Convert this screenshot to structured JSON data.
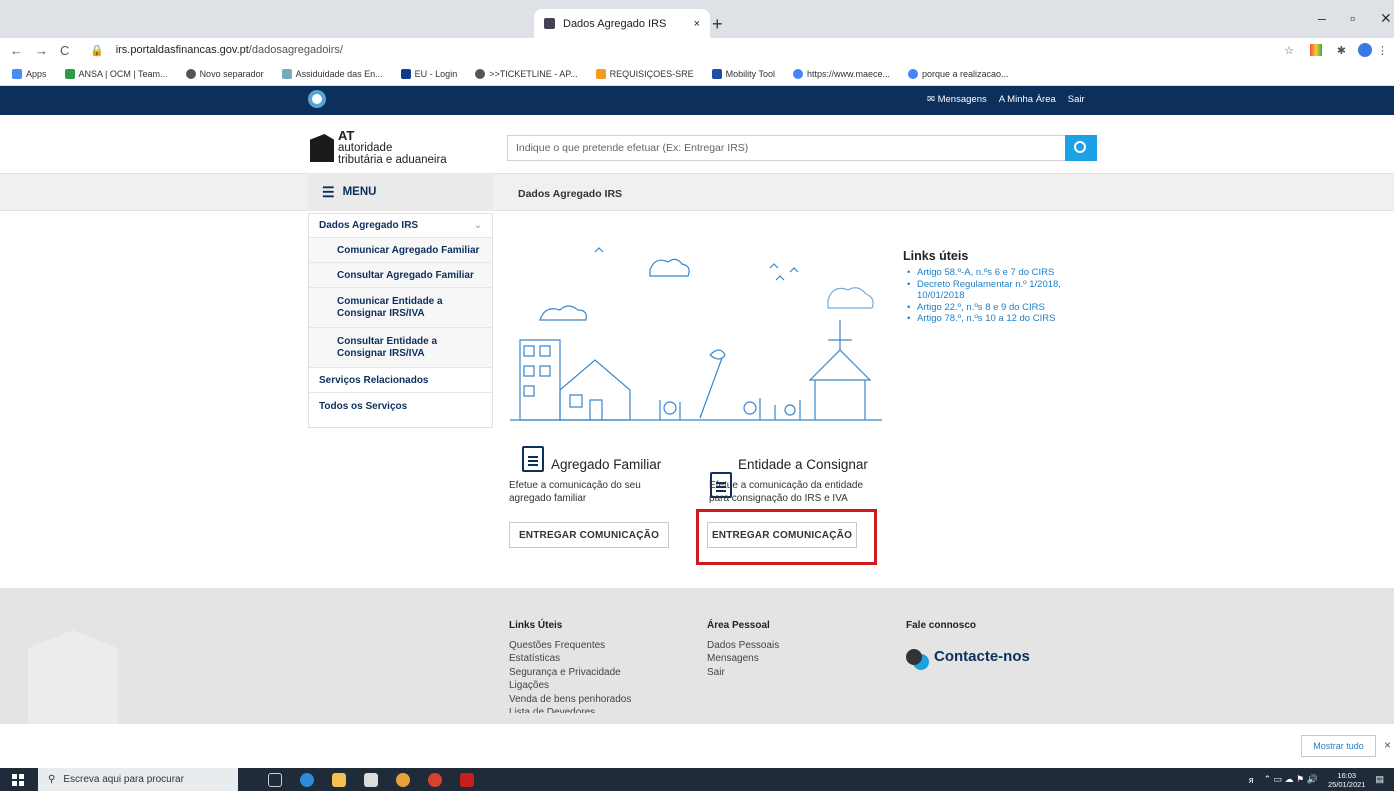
{
  "browser": {
    "tab_title": "Dados Agregado IRS",
    "url_domain": "irs.portaldasfinancas.gov.pt",
    "url_path": "/dadosagregadoirs/",
    "new_tab": "+",
    "close_tab": "×"
  },
  "bookmarks": [
    "Apps",
    "ANSA | OCM | Team...",
    "Novo separador",
    "Assiduidade das En...",
    "EU - Login",
    ">>TICKETLINE - AP...",
    "REQUISIÇOES-SRE",
    "Mobility Tool",
    "https://www.maece...",
    "porque a realizacao..."
  ],
  "topnav": {
    "messages": "Mensagens",
    "my_area": "A Minha Área",
    "exit": "Sair"
  },
  "brand": {
    "line1": "AT",
    "line2": "autoridade",
    "line3": "tributária e aduaneira"
  },
  "search": {
    "placeholder": "Indique o que pretende efetuar (Ex: Entregar IRS)"
  },
  "menu": {
    "label": "MENU",
    "breadcrumb": "Dados Agregado IRS"
  },
  "sidemenu": [
    {
      "label": "Dados Agregado IRS",
      "sub": false
    },
    {
      "label": "Comunicar Agregado Familiar",
      "sub": true
    },
    {
      "label": "Consultar Agregado Familiar",
      "sub": true
    },
    {
      "label": "Comunicar Entidade a Consignar IRS/IVA",
      "sub": true
    },
    {
      "label": "Consultar Entidade a Consignar IRS/IVA",
      "sub": true
    },
    {
      "label": "Serviços Relacionados",
      "sub": false
    },
    {
      "label": "Todos os Serviços",
      "sub": false
    }
  ],
  "cards": [
    {
      "title": "Agregado Familiar",
      "desc_line1": "Efetue a comunicação do seu",
      "desc_line2": "agregado familiar",
      "button": "ENTREGAR COMUNICAÇÃO"
    },
    {
      "title": "Entidade a Consignar",
      "desc_line1": "Efetue a comunicação da entidade",
      "desc_line2": "para consignação do IRS e IVA",
      "button": "ENTREGAR COMUNICAÇÃO"
    }
  ],
  "links": {
    "title": "Links úteis",
    "items": [
      "Artigo 58.º-A, n.ºs 6 e 7 do CIRS",
      "Decreto Regulamentar n.º 1/2018, 10/01/2018",
      "Artigo 22.º, n.ºs 8 e 9 do CIRS",
      "Artigo 78.º, n.ºs 10 a 12 do CIRS"
    ]
  },
  "footer": {
    "col1": {
      "title": "Links Úteis",
      "items": [
        "Questões Frequentes",
        "Estatísticas",
        "Segurança e Privacidade",
        "Ligações",
        "Venda de bens penhorados",
        "Lista de Devedores"
      ]
    },
    "col2": {
      "title": "Área Pessoal",
      "items": [
        "Dados Pessoais",
        "Mensagens",
        "Sair"
      ]
    },
    "col3": {
      "title": "Fale connosco",
      "contact": "Contacte-nos"
    }
  },
  "notification": {
    "show_all": "Mostrar tudo",
    "close": "×"
  },
  "taskbar": {
    "search_placeholder": "Escreva aqui para procurar",
    "time": "16:03",
    "date": "25/01/2021"
  }
}
